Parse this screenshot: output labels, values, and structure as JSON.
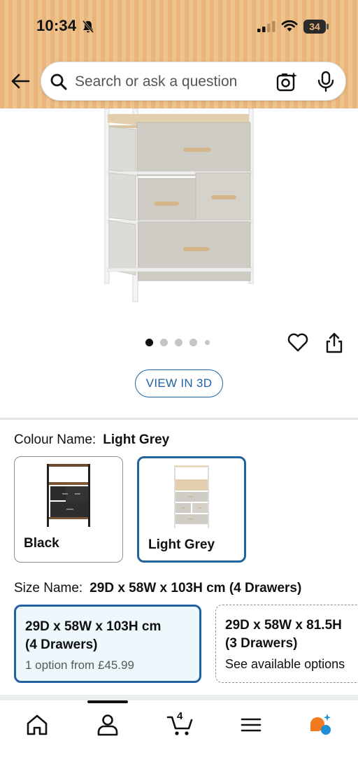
{
  "status_bar": {
    "time": "10:34",
    "battery": "34"
  },
  "search": {
    "placeholder": "Search or ask a question"
  },
  "gallery": {
    "image_count": 5,
    "active_index": 0,
    "view_3d_label": "VIEW IN 3D"
  },
  "colour": {
    "label": "Colour Name:",
    "value": "Light Grey",
    "options": [
      {
        "label": "Black",
        "selected": false
      },
      {
        "label": "Light Grey",
        "selected": true
      }
    ]
  },
  "size": {
    "label": "Size Name:",
    "value": "29D x 58W x 103H cm (4 Drawers)",
    "options": [
      {
        "line1": "29D x 58W x 103H cm",
        "line2": "(4 Drawers)",
        "sub": "1 option from £45.99",
        "selected": true
      },
      {
        "line1": "29D x 58W x 81.5H",
        "line2": "(3 Drawers)",
        "sub": "See available options",
        "selected": false
      }
    ]
  },
  "nav": {
    "cart_count": "4",
    "items": [
      "home-icon",
      "account-icon",
      "cart-icon",
      "menu-icon",
      "rufus-icon"
    ]
  },
  "colors": {
    "header": "#e9b57a",
    "accent_blue": "#2162a1",
    "selected_bg": "#edf7fc",
    "rufus_orange": "#f37b1f",
    "rufus_blue": "#1f8fd8"
  }
}
